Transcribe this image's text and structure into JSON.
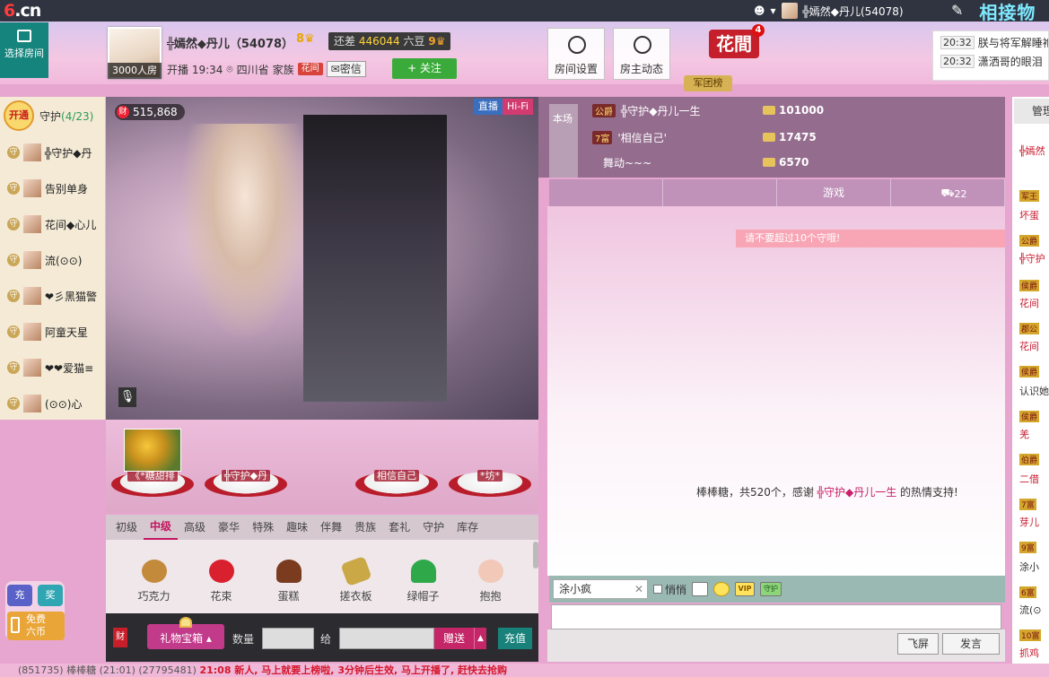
{
  "topbar": {
    "logo_main": "6",
    "logo_suffix": ".cn",
    "user_name": "╬嫣然◆丹儿(54078)",
    "brand_right": "相接物为善"
  },
  "header": {
    "select_room": "选择房间",
    "host_badge": "3000人房",
    "host_name": "╬嫣然◆丹儿（54078）",
    "host_level": "8",
    "coins_prefix": "还差",
    "coins_value": "446044",
    "coins_unit": "六豆",
    "coins_level": "9",
    "live_time": "开播 19:34",
    "location": "四川省",
    "family_label": "家族",
    "family_badge": "花间",
    "mail_label": "密信",
    "follow_label": "+ 关注",
    "tile_settings": "房间设置",
    "tile_news": "房主动态",
    "huajian": "花間",
    "huajian_count": "4",
    "army_btn": "军团榜",
    "messages": [
      {
        "time": "20:32",
        "text": "朕与将军解睡袍"
      },
      {
        "time": "20:32",
        "text": "潇洒哥的眼泪"
      }
    ]
  },
  "guard": {
    "open_label": "开通",
    "title": "守护",
    "count": "(4/23)",
    "members": [
      "╬守护◆丹",
      "告别单身",
      "花间◆心儿",
      "流(⊙⊙)",
      "❤彡黑猫警",
      "阿童天星",
      "❤❤爱猫≡",
      "(⊙⊙)心"
    ]
  },
  "video": {
    "fortune": "515,868",
    "fortune_icon": "财",
    "live_label": "直播",
    "hifi_label": "Hi-Fi"
  },
  "stage": {
    "items": [
      "《*糖甜排",
      "╬守护◆丹",
      "相信自己",
      "*坊*"
    ]
  },
  "gift_tabs": [
    "初级",
    "中级",
    "高级",
    "豪华",
    "特殊",
    "趣味",
    "伴舞",
    "贵族",
    "套礼",
    "守护",
    "库存"
  ],
  "gift_tab_active": "中级",
  "gifts": [
    {
      "name": "巧克力",
      "color": "#c48a3c"
    },
    {
      "name": "花束",
      "color": "#d9202f"
    },
    {
      "name": "蛋糕",
      "color": "#7a3b1f"
    },
    {
      "name": "搓衣板",
      "color": "#c9a845"
    },
    {
      "name": "绿帽子",
      "color": "#2fa84a"
    },
    {
      "name": "抱抱",
      "color": "#f2c9b8"
    }
  ],
  "send": {
    "fortune_mini": "财",
    "giftbox": "礼物宝箱",
    "qty_label": "数量",
    "to_label": "给",
    "send_label": "赠送",
    "recharge_label": "充值"
  },
  "ranking": {
    "side_label": "本场",
    "rows": [
      {
        "level": "公爵",
        "name": "╬守护◆丹儿一生",
        "amount": "101000"
      },
      {
        "level": "7富",
        "name": "'相信自己'",
        "amount": "17475"
      },
      {
        "level": "",
        "name": "舞动~~~",
        "amount": "6570"
      }
    ]
  },
  "right_tabs": [
    {
      "label": "",
      "badge": ""
    },
    {
      "label": "",
      "badge": ""
    },
    {
      "label": "游戏",
      "badge": ""
    },
    {
      "label": "",
      "badge": "22"
    }
  ],
  "chat": {
    "notice": "请不要超过10个守哦!",
    "msg_prefix": "棒棒糖，共520个，感谢",
    "msg_user": "╬守护◆丹儿一生",
    "msg_suffix": "的热情支持!",
    "mention": "涂小疯",
    "quiet_label": "悄悄",
    "vip_label": "VIP",
    "guard_label": "守护",
    "fly_label": "飞屏",
    "speak_label": "发言"
  },
  "far_right": {
    "manage_label": "管理",
    "rows": [
      "╬嫣然",
      "军王",
      "坏蛋",
      "公爵",
      "╬守护",
      "侯爵",
      "花间",
      "郡公",
      "花间",
      "侯爵",
      "认识她",
      "侯爵",
      "羌",
      "伯爵",
      "二借",
      "7富",
      "芽儿",
      "9富",
      "涂小",
      "6富",
      "流(⊙",
      "10富",
      "抓鸡"
    ]
  },
  "float": {
    "pay_label": "充",
    "award_label": "奖",
    "free_label_1": "免费",
    "free_label_2": "六币"
  },
  "ticker": {
    "text_1": "(851735)",
    "text_2": "棒棒糖",
    "text_3": "(21:01)",
    "text_4": "(27795481)",
    "text_5": "21:08 新人, 马上就要上榜啦, 3分钟后生效, 马上开播了, 赶快去抢购"
  },
  "colors": {
    "accent": "#c3155f",
    "teal": "#14847d",
    "topbar": "#2f3440"
  }
}
